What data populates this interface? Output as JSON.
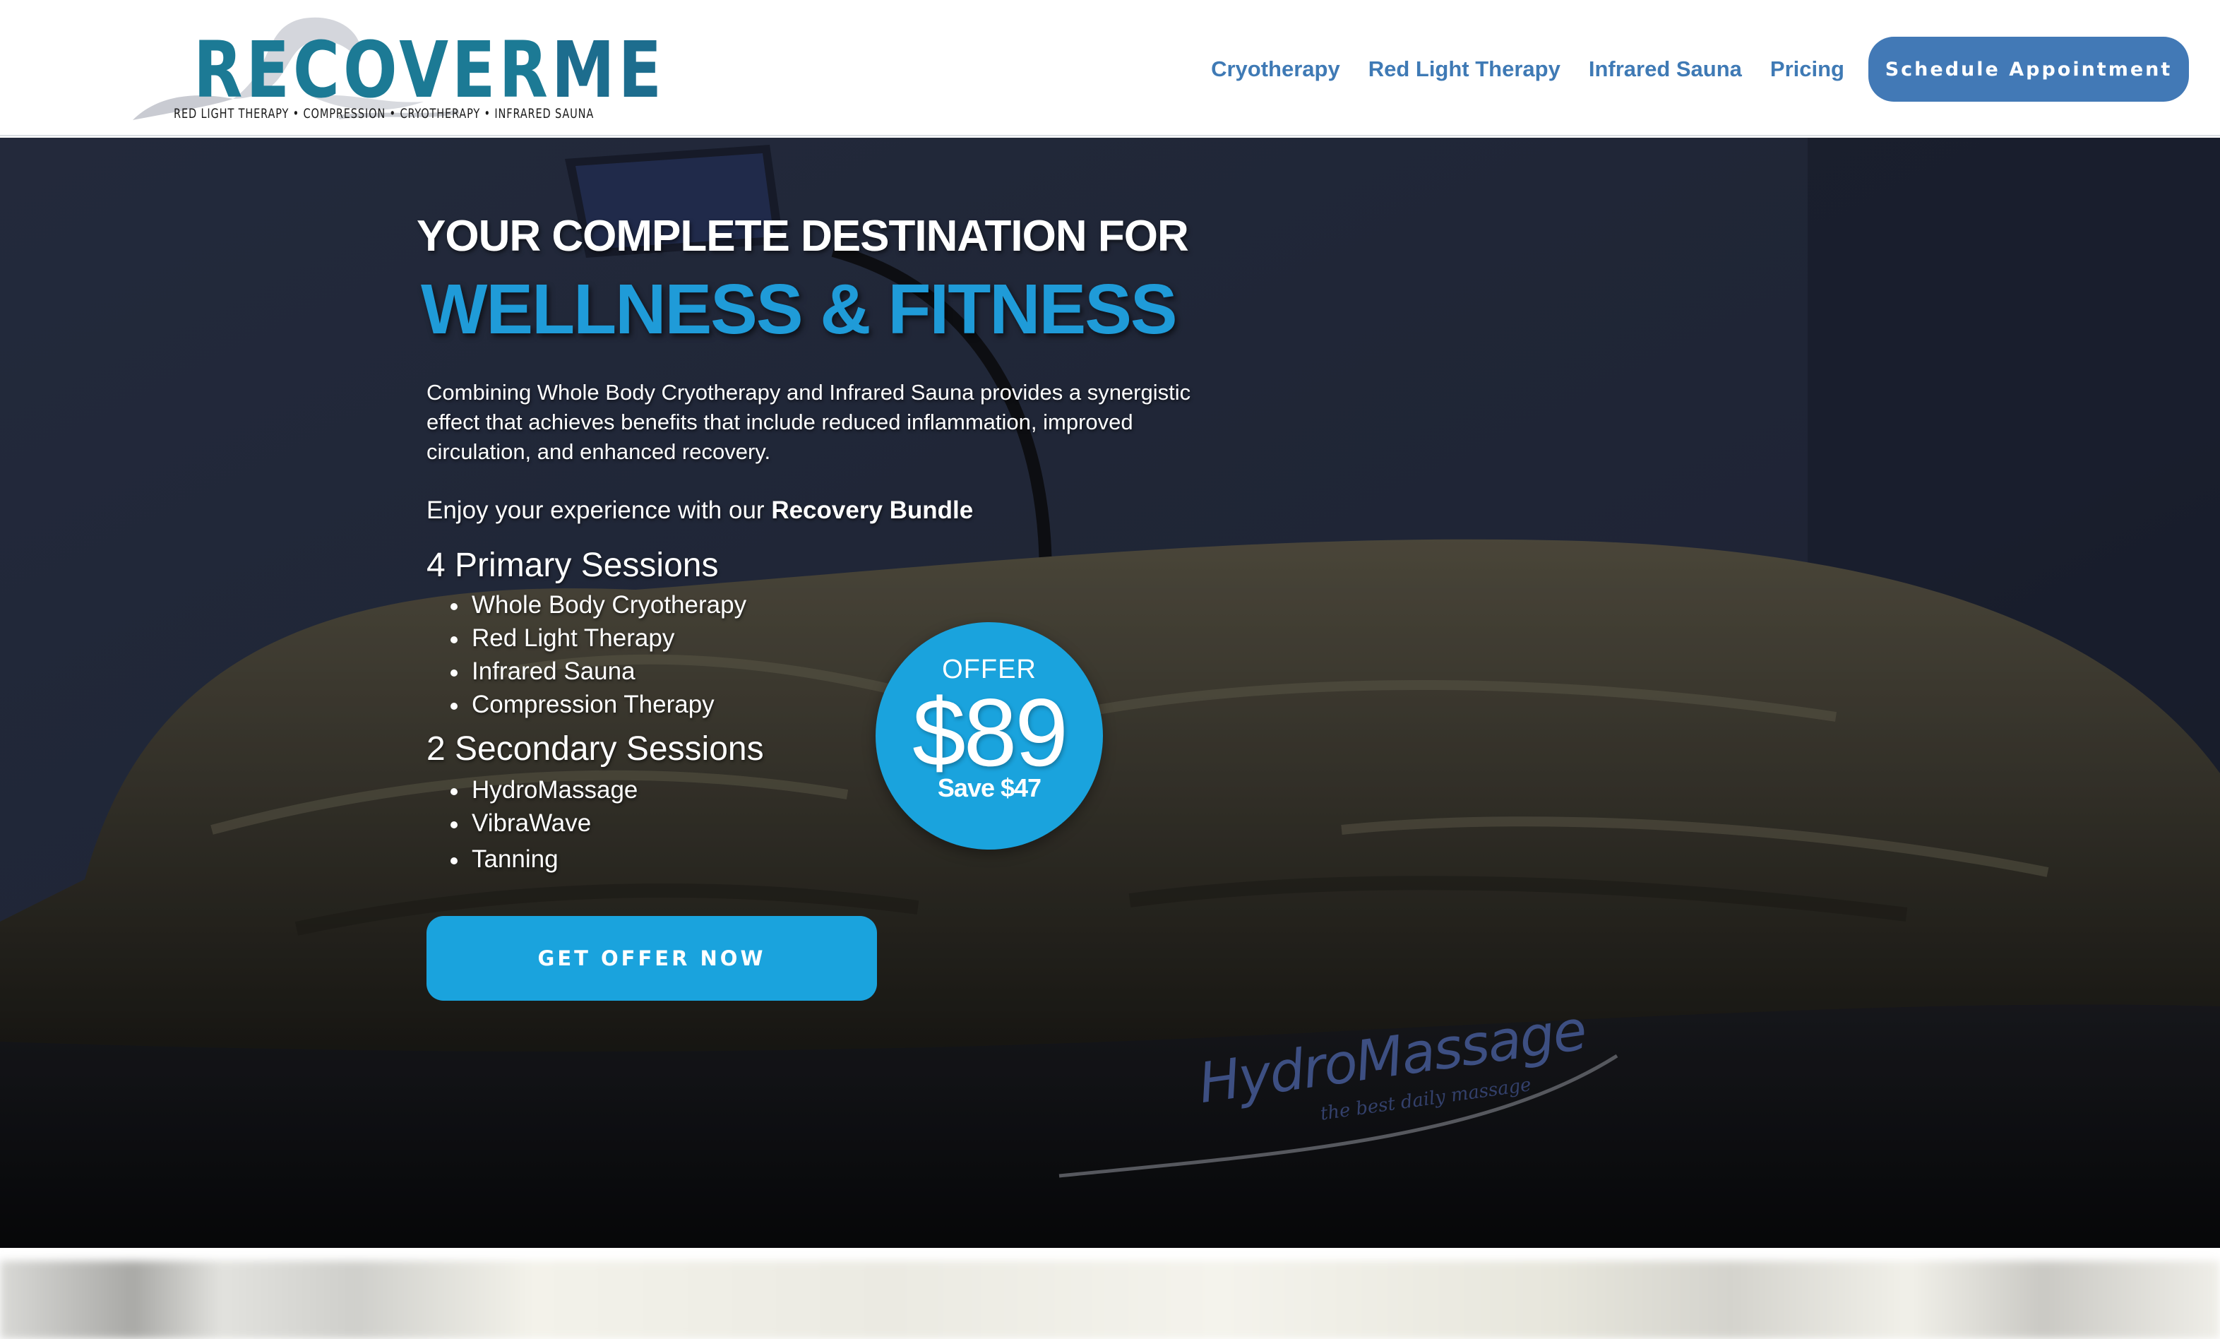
{
  "header": {
    "logo": {
      "word_part1": "RECOVER",
      "word_part2": "ME",
      "tagline": "RED LIGHT THERAPY • COMPRESSION • CRYOTHERAPY • INFRARED SAUNA"
    },
    "nav": [
      {
        "label": "Cryotherapy"
      },
      {
        "label": "Red Light Therapy"
      },
      {
        "label": "Infrared Sauna"
      },
      {
        "label": "Pricing"
      }
    ],
    "cta_label": "Schedule Appointment"
  },
  "hero": {
    "headline_line1": "YOUR COMPLETE DESTINATION FOR",
    "headline_line2": "WELLNESS & FITNESS",
    "intro": "Combining Whole Body Cryotherapy and Infrared Sauna provides a synergistic effect that achieves benefits that include reduced inflammation, improved circulation, and enhanced recovery.",
    "enjoy_prefix": "Enjoy your experience with our ",
    "enjoy_highlight": "Recovery Bundle",
    "primary_title": "4 Primary Sessions",
    "primary_items": [
      "Whole Body Cryotherapy",
      "Red Light Therapy",
      "Infrared Sauna",
      "Compression Therapy"
    ],
    "secondary_title": "2 Secondary Sessions",
    "secondary_items": [
      "HydroMassage",
      "VibraWave",
      "Tanning"
    ],
    "offer": {
      "label": "OFFER",
      "price": "$89",
      "save": "Save $47"
    },
    "cta_label": "GET OFFER NOW",
    "background_brand": "HydroMassage",
    "background_brand_sub": "the best daily massage"
  },
  "colors": {
    "nav_text": "#3f7ab5",
    "nav_button": "#4279b6",
    "accent_blue": "#1aa3dd",
    "headline_blue": "#1f9bd8",
    "logo_teal": "#1c7a95"
  }
}
